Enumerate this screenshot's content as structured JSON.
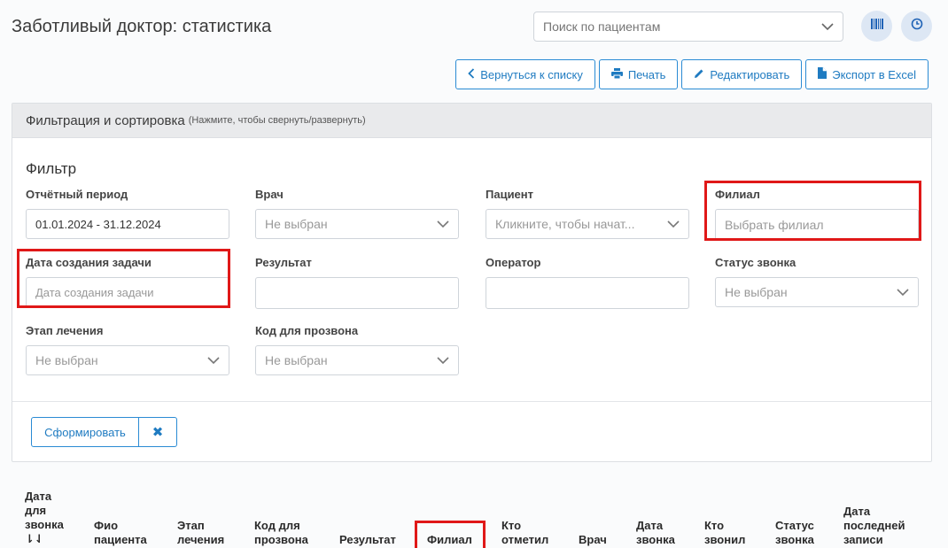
{
  "header": {
    "title": "Заботливый доктор: статистика",
    "search_placeholder": "Поиск по пациентам"
  },
  "actions": {
    "back": "Вернуться к списку",
    "print": "Печать",
    "edit": "Редактировать",
    "export": "Экспорт в Excel"
  },
  "panel": {
    "title": "Фильтрация и сортировка",
    "hint": "(Нажмите, чтобы свернуть/развернуть)",
    "filter_title": "Фильтр"
  },
  "filters": {
    "period": {
      "label": "Отчётный период",
      "value": "01.01.2024 - 31.12.2024"
    },
    "doctor": {
      "label": "Врач",
      "value": "Не выбран"
    },
    "patient": {
      "label": "Пациент",
      "placeholder": "Кликните, чтобы начат..."
    },
    "branch": {
      "label": "Филиал",
      "placeholder": "Выбрать филиал"
    },
    "task_date": {
      "label": "Дата создания задачи",
      "placeholder": "Дата создания задачи"
    },
    "result": {
      "label": "Результат",
      "value": ""
    },
    "operator": {
      "label": "Оператор",
      "value": ""
    },
    "call_status": {
      "label": "Статус звонка",
      "value": "Не выбран"
    },
    "stage": {
      "label": "Этап лечения",
      "value": "Не выбран"
    },
    "call_code": {
      "label": "Код для прозвона",
      "value": "Не выбран"
    }
  },
  "buttons": {
    "generate": "Сформировать",
    "clear": "✖"
  },
  "table": {
    "headers": {
      "call_date": [
        "Дата",
        "для",
        "звонка",
        "⇂⇃"
      ],
      "patient": [
        "Фио",
        "пациента"
      ],
      "stage": [
        "Этап",
        "лечения"
      ],
      "code": [
        "Код для",
        "прозвона"
      ],
      "result": [
        "Результат"
      ],
      "branch": [
        "Филиал"
      ],
      "marked_by": [
        "Кто",
        "отметил"
      ],
      "doctor": [
        "Врач"
      ],
      "date_called": [
        "Дата",
        "звонка"
      ],
      "called_by": [
        "Кто",
        "звонил"
      ],
      "status": [
        "Статус",
        "звонка"
      ],
      "last_record": [
        "Дата",
        "последней",
        "записи"
      ]
    }
  },
  "colors": {
    "accent": "#2a8bd4",
    "highlight": "#e01818"
  }
}
